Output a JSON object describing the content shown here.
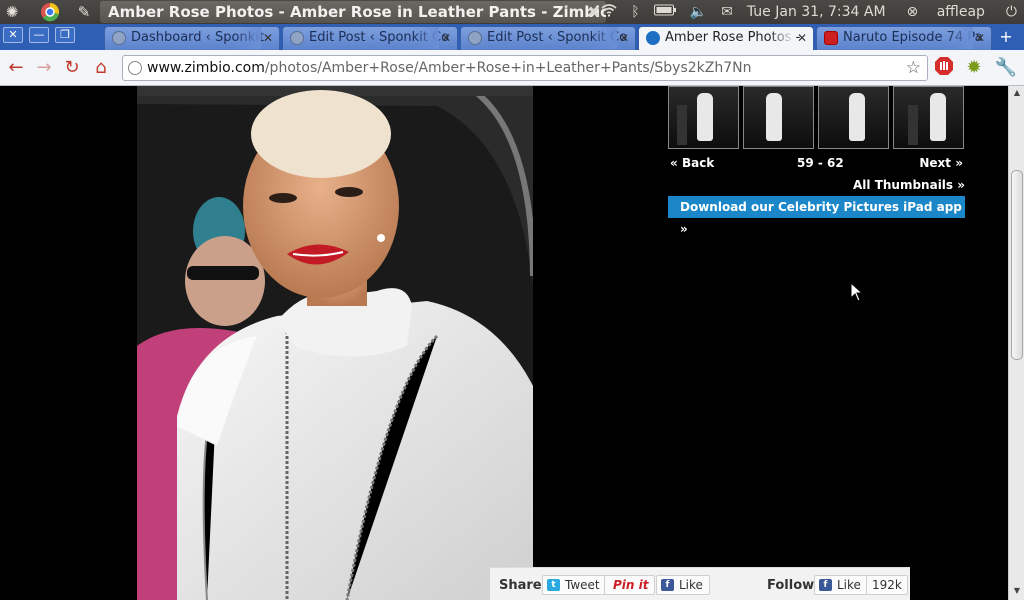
{
  "panel": {
    "window_title": "Amber Rose Photos - Amber Rose in Leather Pants - Zimbio ...",
    "datetime": "Tue Jan 31,  7:34 AM",
    "user": "affleap"
  },
  "tabs": [
    {
      "label": "Dashboard ‹ Sponkit",
      "active": false
    },
    {
      "label": "Edit Post ‹ Sponkit Co",
      "active": false
    },
    {
      "label": "Edit Post ‹ Sponkit Co",
      "active": false
    },
    {
      "label": "Amber Rose Photos - ",
      "active": true
    },
    {
      "label": "Naruto Episode 74 Pa",
      "active": false
    }
  ],
  "toolbar": {
    "url_host": "www.zimbio.com",
    "url_path": "/photos/Amber+Rose/Amber+Rose+in+Leather+Pants/Sbys2kZh7Nn"
  },
  "gallery": {
    "back_label": "Back",
    "range_label": "59 - 62",
    "next_label": "Next",
    "all_thumbnails_label": "All Thumbnails »",
    "ipad_promo_label": "Download our Celebrity Pictures iPad app »"
  },
  "share": {
    "share_label": "Share",
    "tweet_label": "Tweet",
    "pinit_label": "Pin it",
    "like_label": "Like",
    "follow_label": "Follow",
    "follow_like_label": "Like",
    "like_count": "192k"
  },
  "colors": {
    "tab_strip": "#2e5fb4",
    "promo": "#1b87c9",
    "page_bg": "#000000"
  }
}
